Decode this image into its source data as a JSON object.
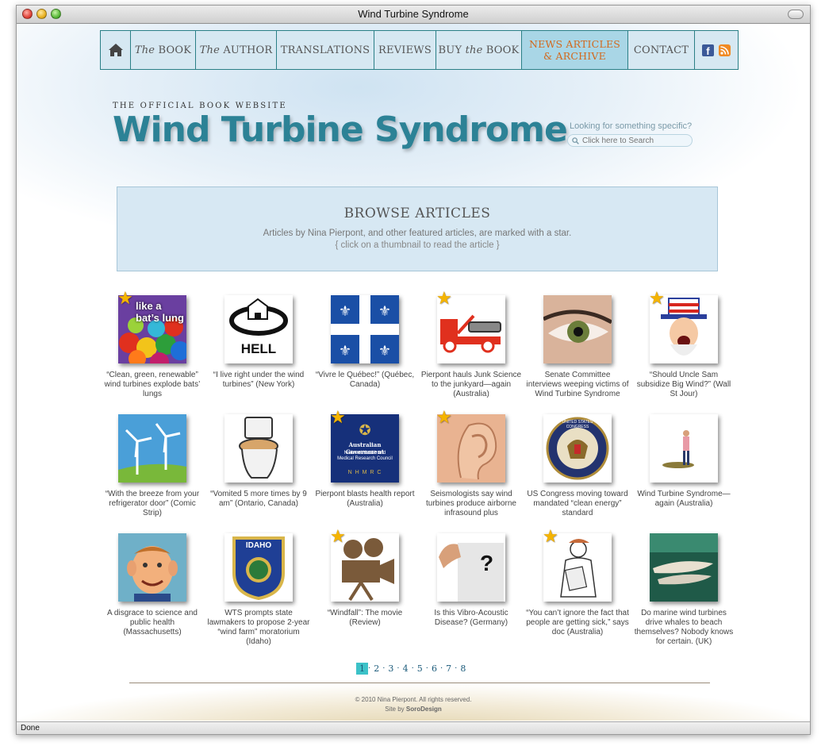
{
  "window": {
    "title": "Wind Turbine Syndrome",
    "status": "Done"
  },
  "nav": {
    "home_icon": "home-icon",
    "items": [
      {
        "label_pre": "The",
        "label_post": " BOOK"
      },
      {
        "label_pre": "The",
        "label_post": " AUTHOR"
      },
      {
        "label": "TRANSLATIONS"
      },
      {
        "label": "REVIEWS"
      },
      {
        "label_pre": "BUY ",
        "label_italic": "the",
        "label_post": " BOOK"
      },
      {
        "label_line1": "NEWS ARTICLES",
        "label_line2": "& ARCHIVE"
      },
      {
        "label": "CONTACT"
      }
    ],
    "facebook_icon": "facebook-icon",
    "facebook_glyph": "f",
    "rss_icon": "rss-icon",
    "active_color": "#d2691e"
  },
  "header": {
    "tagline": "THE OFFICIAL BOOK WEBSITE",
    "title": "Wind Turbine Syndrome",
    "title_color": "#2c8296",
    "search_label": "Looking for something specific?",
    "search_placeholder": "Click here to Search"
  },
  "browse": {
    "title": "BROWSE ARTICLES",
    "subtitle": "Articles by Nina Pierpont, and other featured articles, are marked with a star.",
    "hint": "{ click on a thumbnail to read the article }"
  },
  "articles": [
    {
      "caption": "“Clean, green, renewable” wind turbines explode bats’ lungs",
      "starred": true,
      "thumb": "bat-lung-balloons-image",
      "thumb_text": "like a bat’s lung"
    },
    {
      "caption": "“I live right under the wind turbines” (New York)",
      "starred": false,
      "thumb": "hell-logo-image",
      "thumb_text": "HELL"
    },
    {
      "caption": "“Vivre le Québec!” (Québec, Canada)",
      "starred": false,
      "thumb": "quebec-flag-image"
    },
    {
      "caption": "Pierpont hauls Junk Science to the junkyard—again (Australia)",
      "starred": true,
      "thumb": "tow-truck-image"
    },
    {
      "caption": "Senate Committee interviews weeping victims of Wind Turbine Syndrome",
      "starred": false,
      "thumb": "weeping-eye-image"
    },
    {
      "caption": "“Should Uncle Sam subsidize Big Wind?” (Wall St Jour)",
      "starred": true,
      "thumb": "uncle-sam-image"
    },
    {
      "caption": "“With the breeze from your refrigerator door” (Comic Strip)",
      "starred": false,
      "thumb": "wind-turbines-image"
    },
    {
      "caption": "“Vomited 5 more times by 9 am” (Ontario, Canada)",
      "starred": false,
      "thumb": "toilet-image"
    },
    {
      "caption": "Pierpont blasts health report (Australia)",
      "starred": true,
      "thumb": "nhmrc-logo-image",
      "thumb_text": "Australian Government",
      "thumb_text2": "National Health and Medical Research Council",
      "thumb_text3": "N H M R C"
    },
    {
      "caption": "Seismologists say wind turbines produce airborne infrasound plus",
      "starred": true,
      "thumb": "ear-image"
    },
    {
      "caption": "US Congress moving toward mandated “clean energy” standard",
      "starred": false,
      "thumb": "congress-seal-image",
      "thumb_text": "UNITED STATES CONGRESS"
    },
    {
      "caption": "Wind Turbine Syndrome—again (Australia)",
      "starred": false,
      "thumb": "person-figure-image"
    },
    {
      "caption": "A disgrace to science and public health (Massachusetts)",
      "starred": false,
      "thumb": "alfred-e-neuman-image"
    },
    {
      "caption": "WTS prompts state lawmakers to propose 2-year “wind farm” moratorium (Idaho)",
      "starred": false,
      "thumb": "idaho-shield-image",
      "thumb_text": "IDAHO"
    },
    {
      "caption": "“Windfall”: The movie (Review)",
      "starred": true,
      "thumb": "movie-camera-image"
    },
    {
      "caption": "Is this Vibro-Acoustic Disease? (Germany)",
      "starred": false,
      "thumb": "question-sign-image",
      "thumb_text": "?"
    },
    {
      "caption": "“You can’t ignore the fact that people are getting sick,” says doc (Australia)",
      "starred": true,
      "thumb": "nurse-sketch-image"
    },
    {
      "caption": "Do marine wind turbines drive whales to beach themselves? Nobody knows for certain. (UK)",
      "starred": false,
      "thumb": "whales-image"
    }
  ],
  "pagination": {
    "pages": [
      "1",
      "2",
      "3",
      "4",
      "5",
      "6",
      "7",
      "8"
    ],
    "current": "1",
    "separator": "·"
  },
  "footer": {
    "copyright": "© 2010 Nina Pierpont. All rights reserved.",
    "credit_pre": "Site by ",
    "credit_name": "SoroDesign"
  }
}
